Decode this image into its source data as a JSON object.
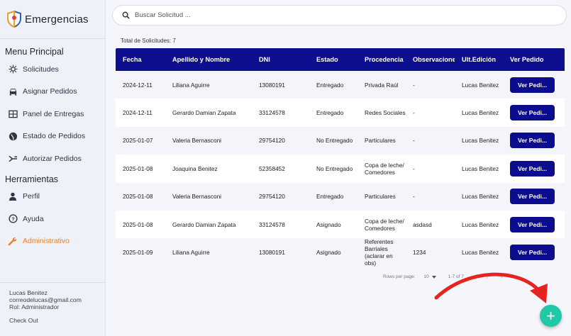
{
  "brand": {
    "title": "Emergencias"
  },
  "sidebar": {
    "menu_title": "Menu Principal",
    "menu_items": [
      {
        "label": "Solicitudes",
        "icon": "virus-icon"
      },
      {
        "label": "Asignar Pedidos",
        "icon": "car-icon"
      },
      {
        "label": "Panel de Entregas",
        "icon": "grid-icon"
      },
      {
        "label": "Estado de Pedidos",
        "icon": "globe-icon"
      },
      {
        "label": "Autorizar Pedidos",
        "icon": "fork-icon"
      }
    ],
    "tools_title": "Herramientas",
    "tool_items": [
      {
        "label": "Perfil",
        "icon": "user-icon"
      },
      {
        "label": "Ayuda",
        "icon": "help-icon"
      },
      {
        "label": "Administrativo",
        "icon": "wrench-icon",
        "active": true
      }
    ],
    "user": {
      "name": "Lucas Benitez",
      "email": "correodelucas@gmail.com",
      "role": "Rol: Administrador",
      "logout": "Check Out"
    }
  },
  "search": {
    "placeholder": "Buscar Solicitud ..."
  },
  "total_label": "Total de Solicitudes: 7",
  "table": {
    "headers": [
      "Fecha",
      "Apellido y Nombre",
      "DNI",
      "Estado",
      "Procedencia",
      "Observaciones",
      "Ult.Edición",
      "Ver Pedido"
    ],
    "rows": [
      [
        "2024-12-11",
        "Liliana Aguirre",
        "13080191",
        "Entregado",
        "Privada Raúl",
        "-",
        "Lucas Benitez"
      ],
      [
        "2024-12-11",
        "Gerardo Damian Zapata",
        "33124578",
        "Entregado",
        "Redes Sociales",
        "-",
        "Lucas Benitez"
      ],
      [
        "2025-01-07",
        "Valeria Bernasconi",
        "29754120",
        "No Entregado",
        "Particulares",
        "-",
        "Lucas Benitez"
      ],
      [
        "2025-01-08",
        "Joaquina Benitez",
        "52358452",
        "No Entregado",
        "Copa de leche/ Comedores",
        "-",
        "Lucas Benitez"
      ],
      [
        "2025-01-08",
        "Valeria Bernasconi",
        "29754120",
        "Entregado",
        "Particulares",
        "-",
        "Lucas Benitez"
      ],
      [
        "2025-01-08",
        "Gerardo Damian Zapata",
        "33124578",
        "Asignado",
        "Copa de leche/ Comedores",
        "asdasd",
        "Lucas Benitez"
      ],
      [
        "2025-01-09",
        "Liliana Aguirre",
        "13080191",
        "Asignado",
        "Referentes Barriales (aclarar en obs)",
        "1234",
        "Lucas Benitez"
      ]
    ],
    "button_label": "Ver Pedi..."
  },
  "pagination": {
    "rows_label": "Rows per page:",
    "rows_value": "10",
    "range": "1-7 of 7"
  },
  "fab": {
    "label": "+"
  },
  "colors": {
    "primary": "#0d0f8f",
    "accent": "#e9822a",
    "fab": "#1fc8a7",
    "arrow": "#e52420"
  }
}
